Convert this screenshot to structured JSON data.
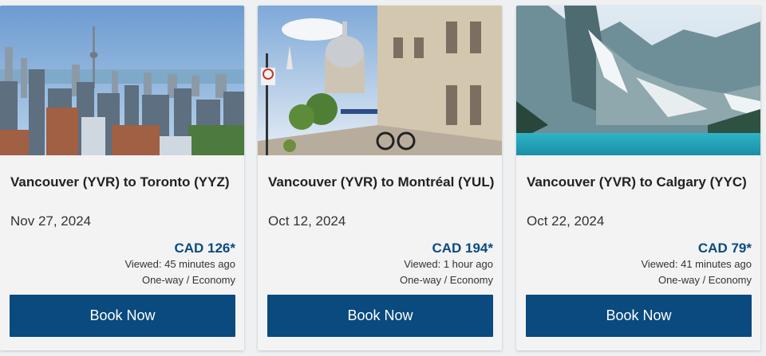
{
  "cards": [
    {
      "image": "toronto-skyline-photo",
      "route": "Vancouver (YVR) to Toronto (YYZ)",
      "date": "Nov 27, 2024",
      "price": "CAD 126*",
      "viewed": "Viewed: 45 minutes ago",
      "fare": "One-way / Economy",
      "button": "Book Now"
    },
    {
      "image": "montreal-old-town-photo",
      "route": "Vancouver (YVR) to Montréal (YUL)",
      "date": "Oct 12, 2024",
      "price": "CAD 194*",
      "viewed": "Viewed: 1 hour ago",
      "fare": "One-way / Economy",
      "button": "Book Now"
    },
    {
      "image": "calgary-rocky-mountains-lake-photo",
      "route": "Vancouver (YVR) to Calgary (YYC)",
      "date": "Oct 22, 2024",
      "price": "CAD 79*",
      "viewed": "Viewed: 41 minutes ago",
      "fare": "One-way / Economy",
      "button": "Book Now"
    }
  ],
  "colors": {
    "price": "#0b4a80",
    "button": "#0a4a7e",
    "card_bg": "#f3f3f3"
  }
}
